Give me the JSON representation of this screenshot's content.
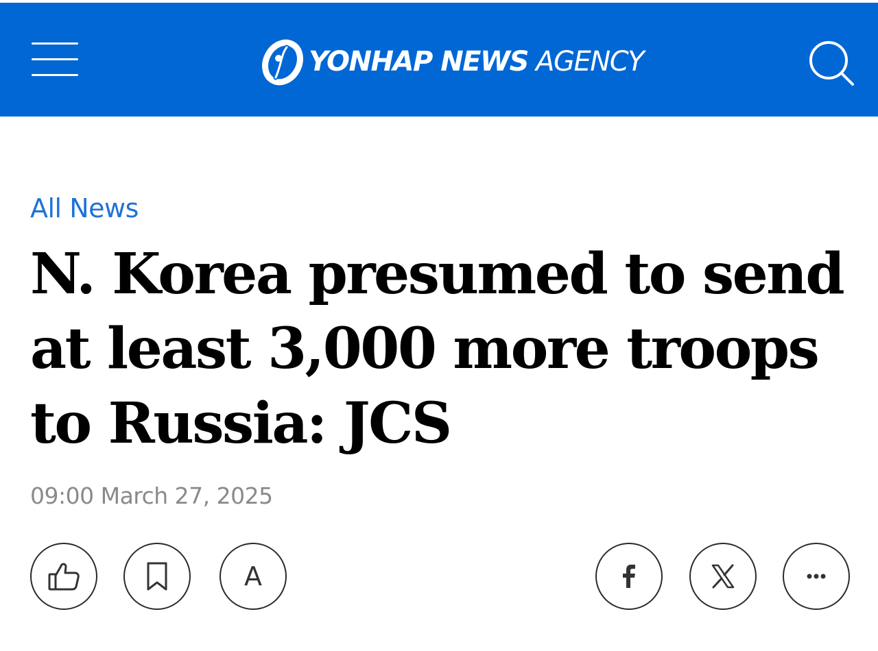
{
  "header": {
    "logo_bold": "YONHAP NEWS",
    "logo_light": "AGENCY",
    "brand_color": "#0167d4",
    "menu_icon": "hamburger-menu-icon",
    "search_icon": "search-icon"
  },
  "article": {
    "category": "All News",
    "headline": "N. Korea presumed to send at least 3,000 more troops to Russia: JCS",
    "timestamp": "09:00 March 27, 2025"
  },
  "actions": {
    "left": [
      {
        "name": "like",
        "icon": "thumbs-up-icon"
      },
      {
        "name": "bookmark",
        "icon": "bookmark-icon"
      },
      {
        "name": "font-size",
        "icon": "font-size-icon",
        "glyph": "A"
      }
    ],
    "right": [
      {
        "name": "facebook-share",
        "icon": "facebook-icon"
      },
      {
        "name": "x-share",
        "icon": "x-icon"
      },
      {
        "name": "more",
        "icon": "more-icon"
      }
    ]
  },
  "colors": {
    "link": "#1f72d8",
    "meta": "#8a8a8a",
    "headline": "#000000"
  }
}
